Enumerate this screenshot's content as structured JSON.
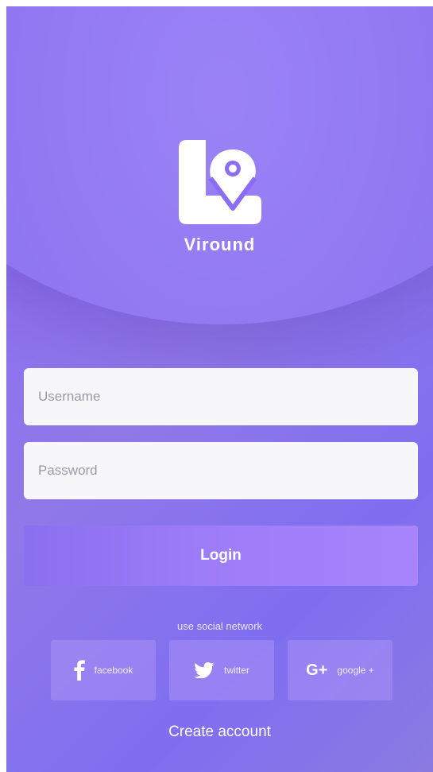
{
  "app": {
    "brand_name": "Viround"
  },
  "form": {
    "username_placeholder": "Username",
    "password_placeholder": "Password",
    "login_label": "Login"
  },
  "social": {
    "caption": "use social network",
    "buttons": [
      {
        "icon": "facebook-icon",
        "label": "facebook"
      },
      {
        "icon": "twitter-icon",
        "label": "twitter"
      },
      {
        "icon": "google-plus-icon",
        "label": "google +"
      }
    ]
  },
  "footer": {
    "create_account_label": "Create account"
  },
  "colors": {
    "background_primary": "#8b6cf4",
    "accent": "#a784fb",
    "field_background": "#f7f7fa",
    "text_on_accent": "#ffffff"
  }
}
